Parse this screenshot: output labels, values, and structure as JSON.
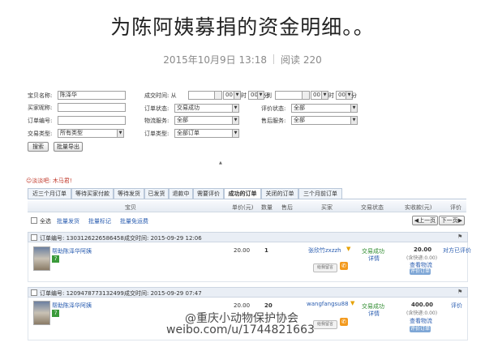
{
  "article": {
    "title": "为陈阿姨募捐的资金明细。。",
    "date": "2015年10月9日 13:18",
    "reads": "阅读 220"
  },
  "filters": {
    "baby_name_label": "宝贝名称:",
    "baby_name_value": "陈泽华",
    "buyer_nick_label": "买家昵称:",
    "order_no_label": "订单编号:",
    "trade_type_label": "交易类型:",
    "trade_type_value": "所有类型",
    "deal_time_label": "成交时间: 从",
    "hour_label1": "时",
    "min_label1": "分",
    "to_label": "到",
    "hour_label2": "时",
    "min_label2": "分",
    "hour_value": "00",
    "min_value": "00",
    "order_status_label": "订单状态:",
    "order_status_value": "交易成功",
    "logistics_label": "物流服务:",
    "logistics_value": "全部",
    "type_label": "订单类型:",
    "type_value": "全部订单",
    "review_status_label": "评价状态:",
    "review_status_value": "全部",
    "aftersale_label": "售后服务:",
    "aftersale_value": "全部",
    "search_btn": "搜索",
    "export_btn": "批量导出"
  },
  "notice": "淡淡吧: 木马君!",
  "tabs": [
    "近三个月订单",
    "等待买家付款",
    "等待发货",
    "已发货",
    "退款中",
    "需要评价",
    "成功的订单",
    "关闭的订单",
    "三个月前订单"
  ],
  "table_headers": [
    "宝贝",
    "单价(元)",
    "数量",
    "售后",
    "买家",
    "交易状态",
    "实收款(元)",
    "评价"
  ],
  "batch": {
    "select_all": "全选",
    "ship": "批量发货",
    "mark": "批量标记",
    "free_ship": "批量免运费",
    "prev": "◀上一页",
    "next": "下一页▶"
  },
  "orders": [
    {
      "order_no": "订单编号: 1303126226586458",
      "deal_time": "成交时间: 2015-09-29 12:06",
      "item": "帮助陈泽华阿姨",
      "price": "20.00",
      "qty": "1",
      "buyer": "张欣竹zxzzh",
      "status": "交易成功",
      "detail": "详情",
      "amount": "20.00",
      "freight": "(含快递:0.00)",
      "view_logistics": "查看物流",
      "pill": "评价订单",
      "review": "对方已评价",
      "leave_msg": "给我留言"
    },
    {
      "order_no": "订单编号: 1209478773132499",
      "deal_time": "成交时间: 2015-09-29 07:47",
      "item": "帮助陈泽华阿姨",
      "price": "20.00",
      "qty": "20",
      "buyer": "wangfangsu88",
      "status": "交易成功",
      "detail": "详情",
      "amount": "400.00",
      "freight": "(含快递:0.00)",
      "view_logistics": "查看物流",
      "pill": "评价订单",
      "review": "评价",
      "leave_msg": "给我留言"
    }
  ],
  "watermark": {
    "line1": "@重庆小动物保护协会",
    "line2": "weibo.com/u/1744821663"
  },
  "colors": {
    "accent": "#2a5db0",
    "success": "#2e8b2e",
    "tab_border": "#b9c7d9"
  }
}
